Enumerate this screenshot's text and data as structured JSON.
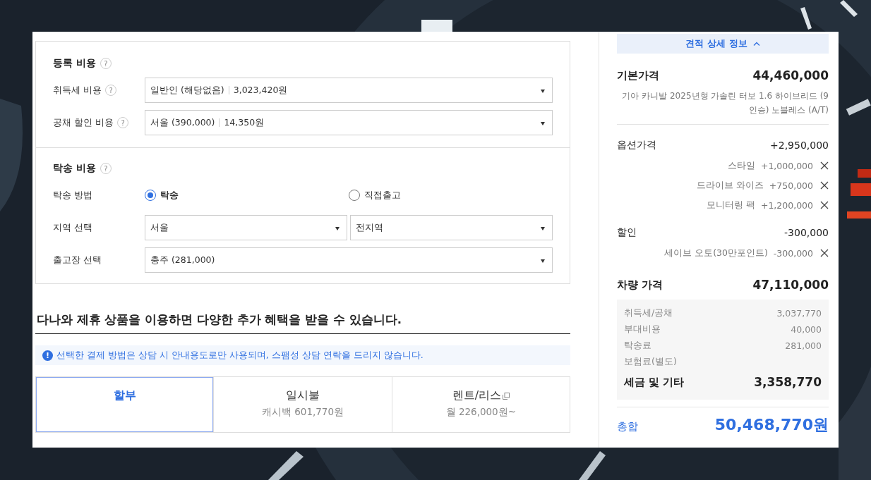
{
  "registration": {
    "title": "등록 비용",
    "help": "?",
    "rows": [
      {
        "label": "취득세 비용",
        "help": "?",
        "value": "일반인 (해당없음)",
        "amount": "3,023,420원"
      },
      {
        "label": "공채 할인 비용",
        "help": "?",
        "value": "서울 (390,000)",
        "amount": "14,350원"
      }
    ]
  },
  "delivery": {
    "title": "탁송 비용",
    "help": "?",
    "method": {
      "label": "탁송 방법",
      "options": [
        {
          "label": "탁송",
          "selected": true
        },
        {
          "label": "직접출고",
          "selected": false
        }
      ]
    },
    "region": {
      "label": "지역 선택",
      "selects": [
        "서울",
        "전지역"
      ]
    },
    "depot": {
      "label": "출고장 선택",
      "value": "충주 (281,000)"
    }
  },
  "promo": {
    "title": "다나와 제휴 상품을 이용하면 다양한 추가 혜택을 받을 수 있습니다.",
    "notice_icon": "!",
    "notice": "선택한 결제 방법은 상담 시 안내용도로만 사용되며, 스팸성 상담 연락을 드리지 않습니다."
  },
  "payment_tabs": [
    {
      "label": "할부",
      "selected": true
    },
    {
      "label": "일시불",
      "sub": "캐시백 601,770원",
      "selected": false
    },
    {
      "label": "렌트/리스",
      "sub": "월 226,000원~",
      "selected": false,
      "external": true
    }
  ],
  "summary": {
    "toggle": "견적 상세 정보",
    "expanded": true,
    "base": {
      "label": "기본가격",
      "value": "44,460,000",
      "desc": "기아 카니발 2025년형 가솔린 터보 1.6 하이브리드 (9 인승) 노블레스 (A/T)"
    },
    "options": {
      "label": "옵션가격",
      "value": "+2,950,000",
      "items": [
        {
          "label": "스타일",
          "value": "+1,000,000"
        },
        {
          "label": "드라이브 와이즈",
          "value": "+750,000"
        },
        {
          "label": "모니터링 팩",
          "value": "+1,200,000"
        }
      ]
    },
    "discount": {
      "label": "할인",
      "value": "-300,000",
      "items": [
        {
          "label": "세이브 오토(30만포인트)",
          "value": "-300,000"
        }
      ]
    },
    "vehicle": {
      "label": "차량 가격",
      "value": "47,110,000"
    },
    "taxes": {
      "items": [
        {
          "label": "취득세/공채",
          "value": "3,037,770"
        },
        {
          "label": "부대비용",
          "value": "40,000"
        },
        {
          "label": "탁송료",
          "value": "281,000"
        },
        {
          "label": "보험료(별도)"
        }
      ],
      "total_label": "세금 및 기타",
      "total": "3,358,770"
    },
    "grand": {
      "label": "총합",
      "value": "50,468,770원"
    }
  }
}
